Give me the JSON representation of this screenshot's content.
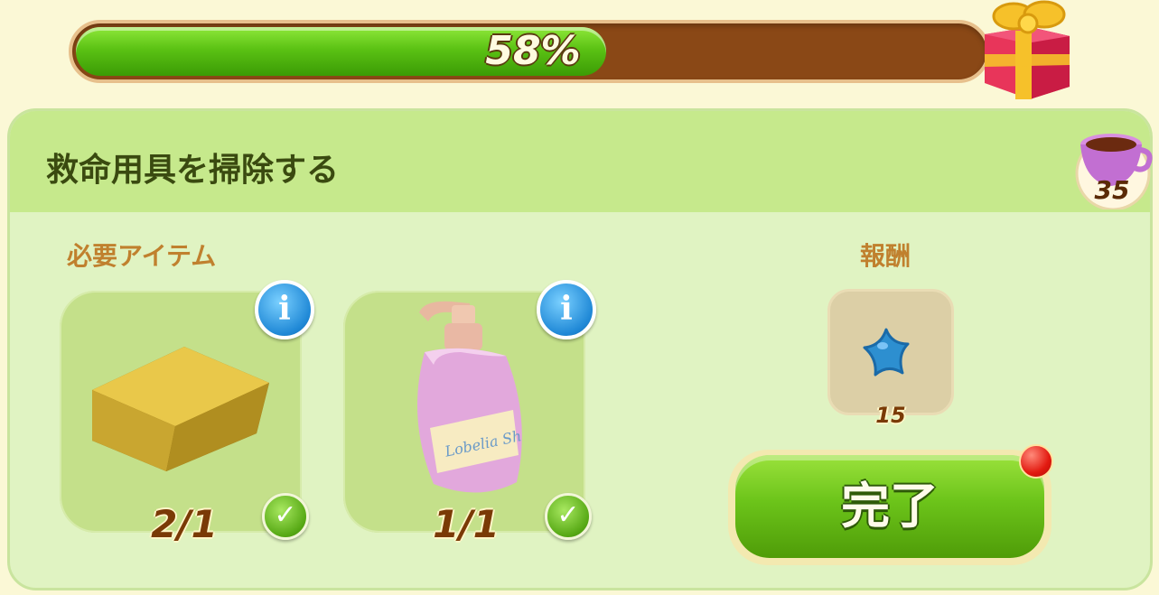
{
  "progress": {
    "value": 0.58,
    "label": "58%"
  },
  "task": {
    "title": "救命用具を掃除する"
  },
  "currency": {
    "icon": "teacup-icon",
    "amount": "35"
  },
  "required": {
    "label": "必要アイテム",
    "items": [
      {
        "icon": "sponge-icon",
        "count": "2/1",
        "status": "checkmark-icon"
      },
      {
        "icon": "soap-bottle-icon",
        "count": "1/1",
        "status": "checkmark-icon"
      }
    ]
  },
  "reward": {
    "label": "報酬",
    "icon": "blue-star-icon",
    "amount": "15"
  },
  "complete_button": {
    "label": "完了"
  },
  "colors": {
    "progress_fill": "#5bc214",
    "progress_track": "#8a4816",
    "panel": "#e0f3c2",
    "header": "#c6e98c",
    "accent_orange": "#c0802e"
  }
}
